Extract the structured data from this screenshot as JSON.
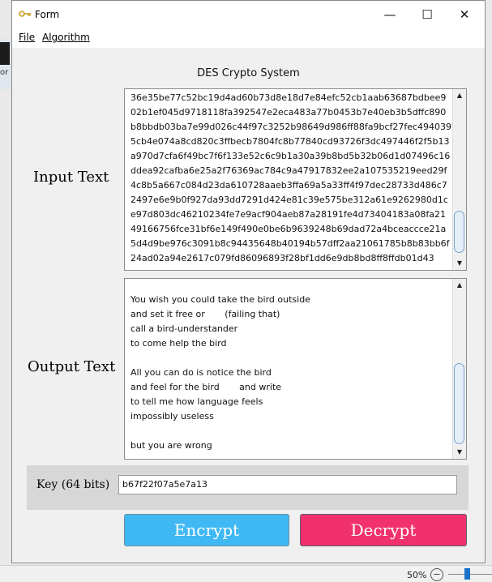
{
  "window": {
    "title": "Form",
    "minimize_glyph": "—",
    "maximize_glyph": "☐",
    "close_glyph": "✕"
  },
  "menu": {
    "file": "File",
    "algorithm": "Algorithm"
  },
  "heading": "DES Crypto System",
  "input": {
    "label": "Input Text",
    "lines": [
      "36e35be77c52bc19d4ad60b73d8e18d7e84efc52cb1aab63687bdbee9",
      "02b1ef045d9718118fa392547e2eca483a77b0453b7e40eb3b5dffc890",
      "b8bbdb03ba7e99d026c44f97c3252b98649d986ff88fa9bcf27fec494039",
      "5cb4e074a8cd820c3ffbecb7804fc8b77840cd93726f3dc497446f2f5b13",
      "a970d7cfa6f49bc7f6f133e52c6c9b1a30a39b8bd5b32b06d1d07496c16",
      "ddea92cafba6e25a2f76369ac784c9a47917832ee2a107535219eed29f",
      "4c8b5a667c084d23da610728aaeb3ffa69a5a33ff4f97dec28733d486c7",
      "2497e6e9b0f927da93dd7291d424e81c39e575be312a61e9262980d1c",
      "e97d803dc46210234fe7e9acf904aeb87a28191fe4d73404183a08fa21",
      "49166756fce31bf6e149f490e0be6b9639248b69dad72a4bceaccce21a",
      "5d4d9be976c3091b8c94435648b40194b57dff2aa21061785b8b83bb6f",
      "24ad02a94e2617c079fd86096893f28bf1dd6e9db8bd8ff8ffdb01d43"
    ]
  },
  "output": {
    "label": "Output Text",
    "lines": [
      "You wish you could take the bird outside",
      "and set it free or       (failing that)",
      "call a bird-understander",
      "to come help the bird",
      "",
      "All you can do is notice the bird",
      "and feel for the bird       and write",
      "to tell me how language feels",
      "impossibly useless",
      "",
      "but you are wrong"
    ]
  },
  "key": {
    "label": "Key (64 bits)",
    "value": "b67f22f07a5e7a13"
  },
  "buttons": {
    "encrypt": "Encrypt",
    "decrypt": "Decrypt"
  },
  "statusbar": {
    "zoom": "50%",
    "zoom_out": "−"
  },
  "background_fragment": "or",
  "colors": {
    "encrypt": "#3fb8f3",
    "decrypt": "#f0316e",
    "key_panel": "#d7d7d7"
  }
}
